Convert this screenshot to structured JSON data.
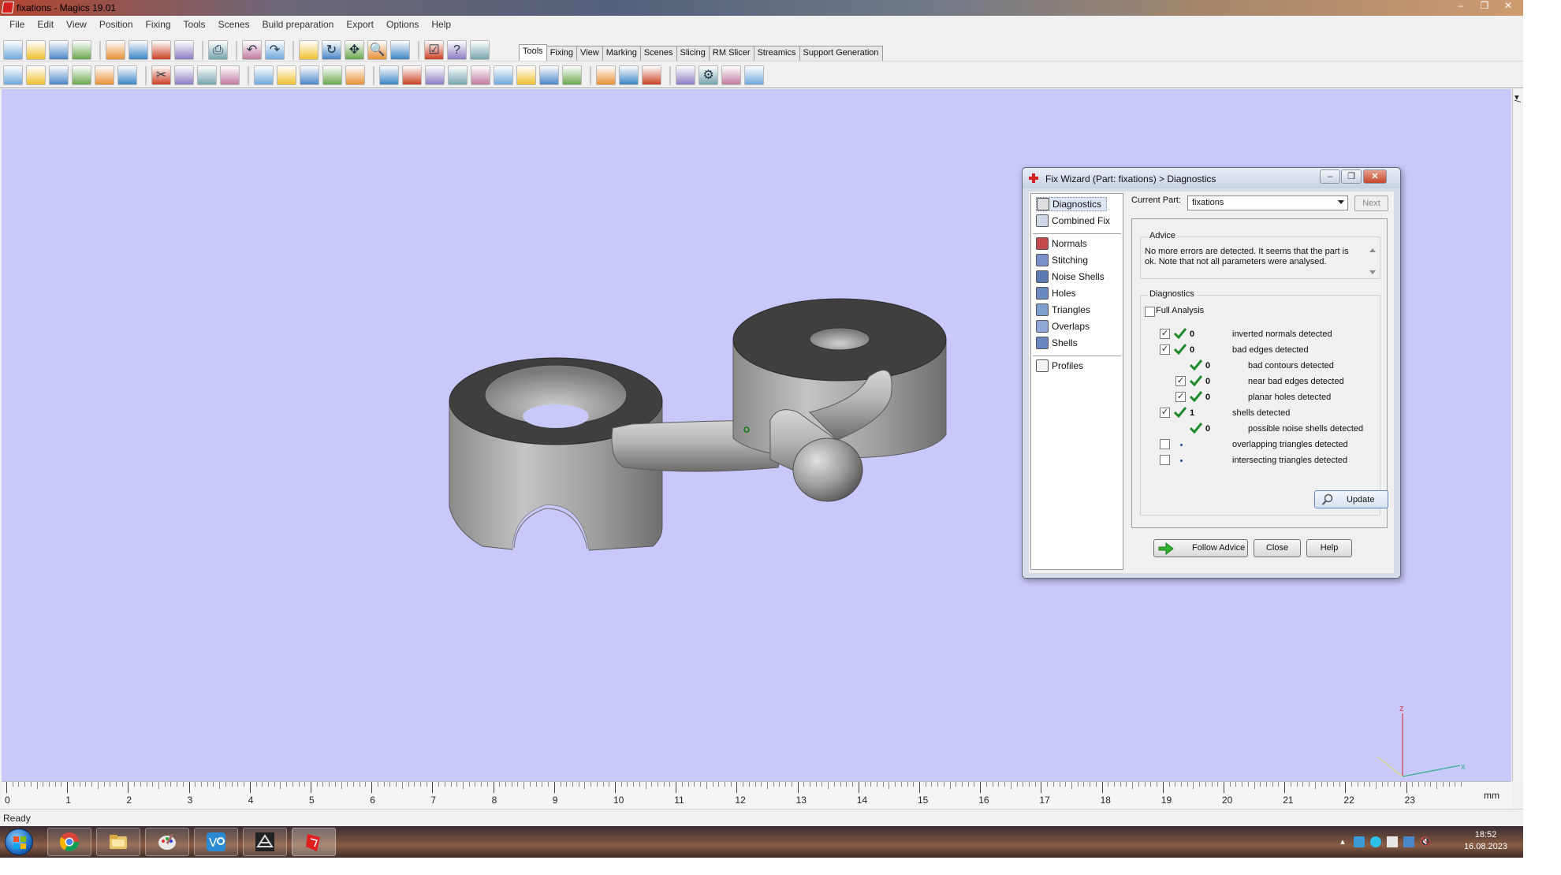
{
  "window": {
    "title": "fixations - Magics 19.01",
    "controls": [
      "–",
      "❐",
      "✕"
    ]
  },
  "menubar": [
    "File",
    "Edit",
    "View",
    "Position",
    "Fixing",
    "Tools",
    "Scenes",
    "Build preparation",
    "Export",
    "Options",
    "Help"
  ],
  "ribbon_tabs": [
    "Tools",
    "Fixing",
    "View",
    "Marking",
    "Scenes",
    "Slicing",
    "RM Slicer",
    "Streamics",
    "Support Generation"
  ],
  "ribbon_active": "Tools",
  "toolbar1_icons": [
    "new-file-icon",
    "open-folder-icon",
    "save-icon",
    "save-as-icon",
    "import-part-icon",
    "save-part-icon",
    "export-part-icon",
    "unload-part-icon",
    "print-icon",
    "undo-icon",
    "redo-icon",
    "select-icon",
    "rotate-view-icon",
    "pan-icon",
    "zoom-icon",
    "zoom-window-icon",
    "checklist-icon",
    "help-icon",
    "context-help-icon"
  ],
  "toolbar2_icons": [
    "translate-icon",
    "translate-to-default-icon",
    "rotate-icon",
    "rotate-to-default-icon",
    "mirror-icon",
    "duplicate-icon",
    "cut-icon",
    "copy-icon",
    "paste-icon",
    "part-properties-icon",
    "measure-icon",
    "box-icon",
    "sphere-icon",
    "cylinder-icon",
    "cone-icon",
    "view-front-icon",
    "view-back-icon",
    "view-side-icon",
    "view-top-icon",
    "view-iso-icon",
    "shaded-icon",
    "wireframe-icon",
    "section-icon",
    "explode-icon",
    "fix-wizard-icon",
    "mesh-icon",
    "hollow-icon",
    "offset-icon",
    "gear-icon",
    "layers-icon",
    "support-icon"
  ],
  "viewport": {
    "background": "#c8c8fa",
    "ruler_labels": [
      "0",
      "1",
      "2",
      "3",
      "4",
      "5",
      "6",
      "7",
      "8",
      "9",
      "10",
      "11",
      "12",
      "13",
      "14",
      "15",
      "16",
      "17",
      "18",
      "19",
      "20",
      "21",
      "22",
      "23"
    ],
    "ruler_unit": "mm",
    "axis_labels": {
      "z": "z",
      "x": "x"
    }
  },
  "status": "Ready",
  "taskbar": {
    "apps": [
      "chrome-icon",
      "file-explorer-icon",
      "paint-icon",
      "vault-icon",
      "cad-icon",
      "magics-icon"
    ],
    "time": "18:52",
    "date": "16.08.2023"
  },
  "fix_wizard": {
    "title": "Fix Wizard (Part: fixations) > Diagnostics",
    "nav_top": [
      {
        "label": "Diagnostics",
        "icon": "magnifier-icon",
        "selected": true
      },
      {
        "label": "Combined Fix",
        "icon": "cube-icon",
        "selected": false
      }
    ],
    "nav_middle": [
      {
        "label": "Normals",
        "icon": "normals-icon"
      },
      {
        "label": "Stitching",
        "icon": "stitching-icon"
      },
      {
        "label": "Noise Shells",
        "icon": "noise-shells-icon"
      },
      {
        "label": "Holes",
        "icon": "holes-icon"
      },
      {
        "label": "Triangles",
        "icon": "triangles-icon"
      },
      {
        "label": "Overlaps",
        "icon": "overlaps-icon"
      },
      {
        "label": "Shells",
        "icon": "shells-icon"
      }
    ],
    "nav_bottom": [
      {
        "label": "Profiles",
        "icon": "profiles-icon"
      }
    ],
    "current_part_label": "Current Part:",
    "current_part_value": "fixations",
    "next_label": "Next",
    "advice_title": "Advice",
    "advice_text": "No more errors are detected. It seems that the part is ok. Note that not all parameters were analysed.",
    "diagnostics_title": "Diagnostics",
    "full_analysis_label": "Full Analysis",
    "full_analysis_checked": false,
    "rows": [
      {
        "checkbox": true,
        "checked": true,
        "status": "ok",
        "count": "0",
        "label": "inverted normals detected",
        "indent": 0
      },
      {
        "checkbox": true,
        "checked": true,
        "status": "ok",
        "count": "0",
        "label": "bad edges detected",
        "indent": 0
      },
      {
        "checkbox": false,
        "checked": false,
        "status": "ok",
        "count": "0",
        "label": "bad contours detected",
        "indent": 1
      },
      {
        "checkbox": true,
        "checked": true,
        "status": "ok",
        "count": "0",
        "label": "near bad edges detected",
        "indent": 1
      },
      {
        "checkbox": true,
        "checked": true,
        "status": "ok",
        "count": "0",
        "label": "planar holes detected",
        "indent": 1
      },
      {
        "checkbox": true,
        "checked": true,
        "status": "ok",
        "count": "1",
        "label": "shells detected",
        "indent": 0
      },
      {
        "checkbox": false,
        "checked": false,
        "status": "ok",
        "count": "0",
        "label": "possible noise shells detected",
        "indent": 1
      },
      {
        "checkbox": true,
        "checked": false,
        "status": "pending",
        "count": "",
        "label": "overlapping triangles detected",
        "indent": 0
      },
      {
        "checkbox": true,
        "checked": false,
        "status": "pending",
        "count": "",
        "label": "intersecting triangles detected",
        "indent": 0
      }
    ],
    "update_label": "Update",
    "follow_advice_label": "Follow Advice",
    "close_label": "Close",
    "help_label": "Help"
  }
}
